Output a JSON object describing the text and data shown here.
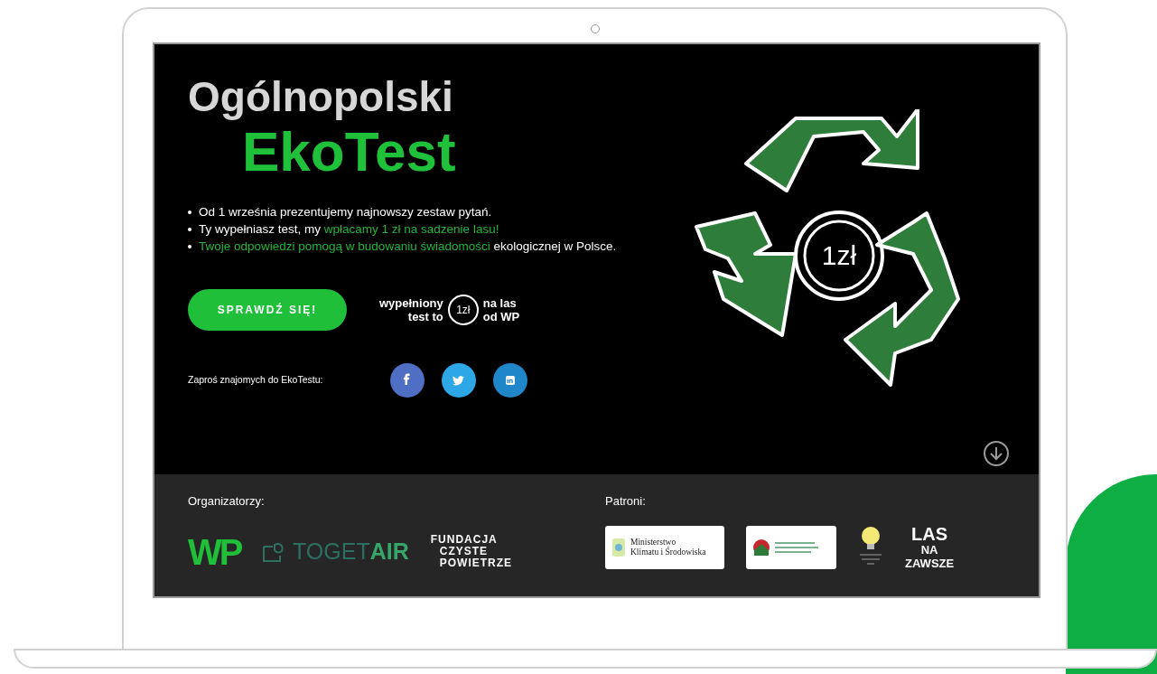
{
  "hero": {
    "title_line1": "Ogólnopolski",
    "title_line2": "EkoTest",
    "bullets": [
      [
        {
          "text": "Od 1 września prezentujemy najnowszy zestaw pytań.",
          "highlight": false
        }
      ],
      [
        {
          "text": "Ty wypełniasz test, my ",
          "highlight": false
        },
        {
          "text": "wpłacamy 1 zł na sadzenie lasu!",
          "highlight": true
        }
      ],
      [
        {
          "text": "Twoje odpowiedzi pomogą w budowaniu świadomości",
          "highlight": true
        },
        {
          "text": " ekologicznej w Polsce.",
          "highlight": false
        }
      ]
    ],
    "cta": "SPRAWDŹ SIĘ!",
    "badge": {
      "left": [
        "wypełniony",
        "test to"
      ],
      "coin": "1zł",
      "right": [
        "na las",
        "od WP"
      ]
    },
    "share": {
      "label": "Zaproś znajomych do EkoTestu:",
      "networks": [
        {
          "kind": "facebook",
          "color": "#4e6fc4"
        },
        {
          "kind": "twitter",
          "color": "#2ea7e6"
        },
        {
          "kind": "linkedin",
          "color": "#1f87c9"
        }
      ]
    },
    "graphic_coin": "1zł"
  },
  "footer": {
    "organizers": {
      "label": "Organizatorzy:",
      "logos": [
        {
          "kind": "wp",
          "text": "WP"
        },
        {
          "kind": "togetair",
          "text": "TOGET",
          "accent": "AIR"
        },
        {
          "kind": "fundacja",
          "lines": [
            "FUNDACJA",
            "CZYSTE",
            "POWIETRZE"
          ]
        }
      ]
    },
    "patrons": {
      "label": "Patroni:",
      "logos": [
        {
          "kind": "ministerstwo",
          "lines": [
            "Ministerstwo",
            "Klimatu i Środowiska"
          ]
        },
        {
          "kind": "nfos"
        },
        {
          "kind": "bulb"
        },
        {
          "kind": "las",
          "lines": [
            "LAS",
            "NA",
            "ZAWSZE"
          ]
        }
      ]
    }
  }
}
